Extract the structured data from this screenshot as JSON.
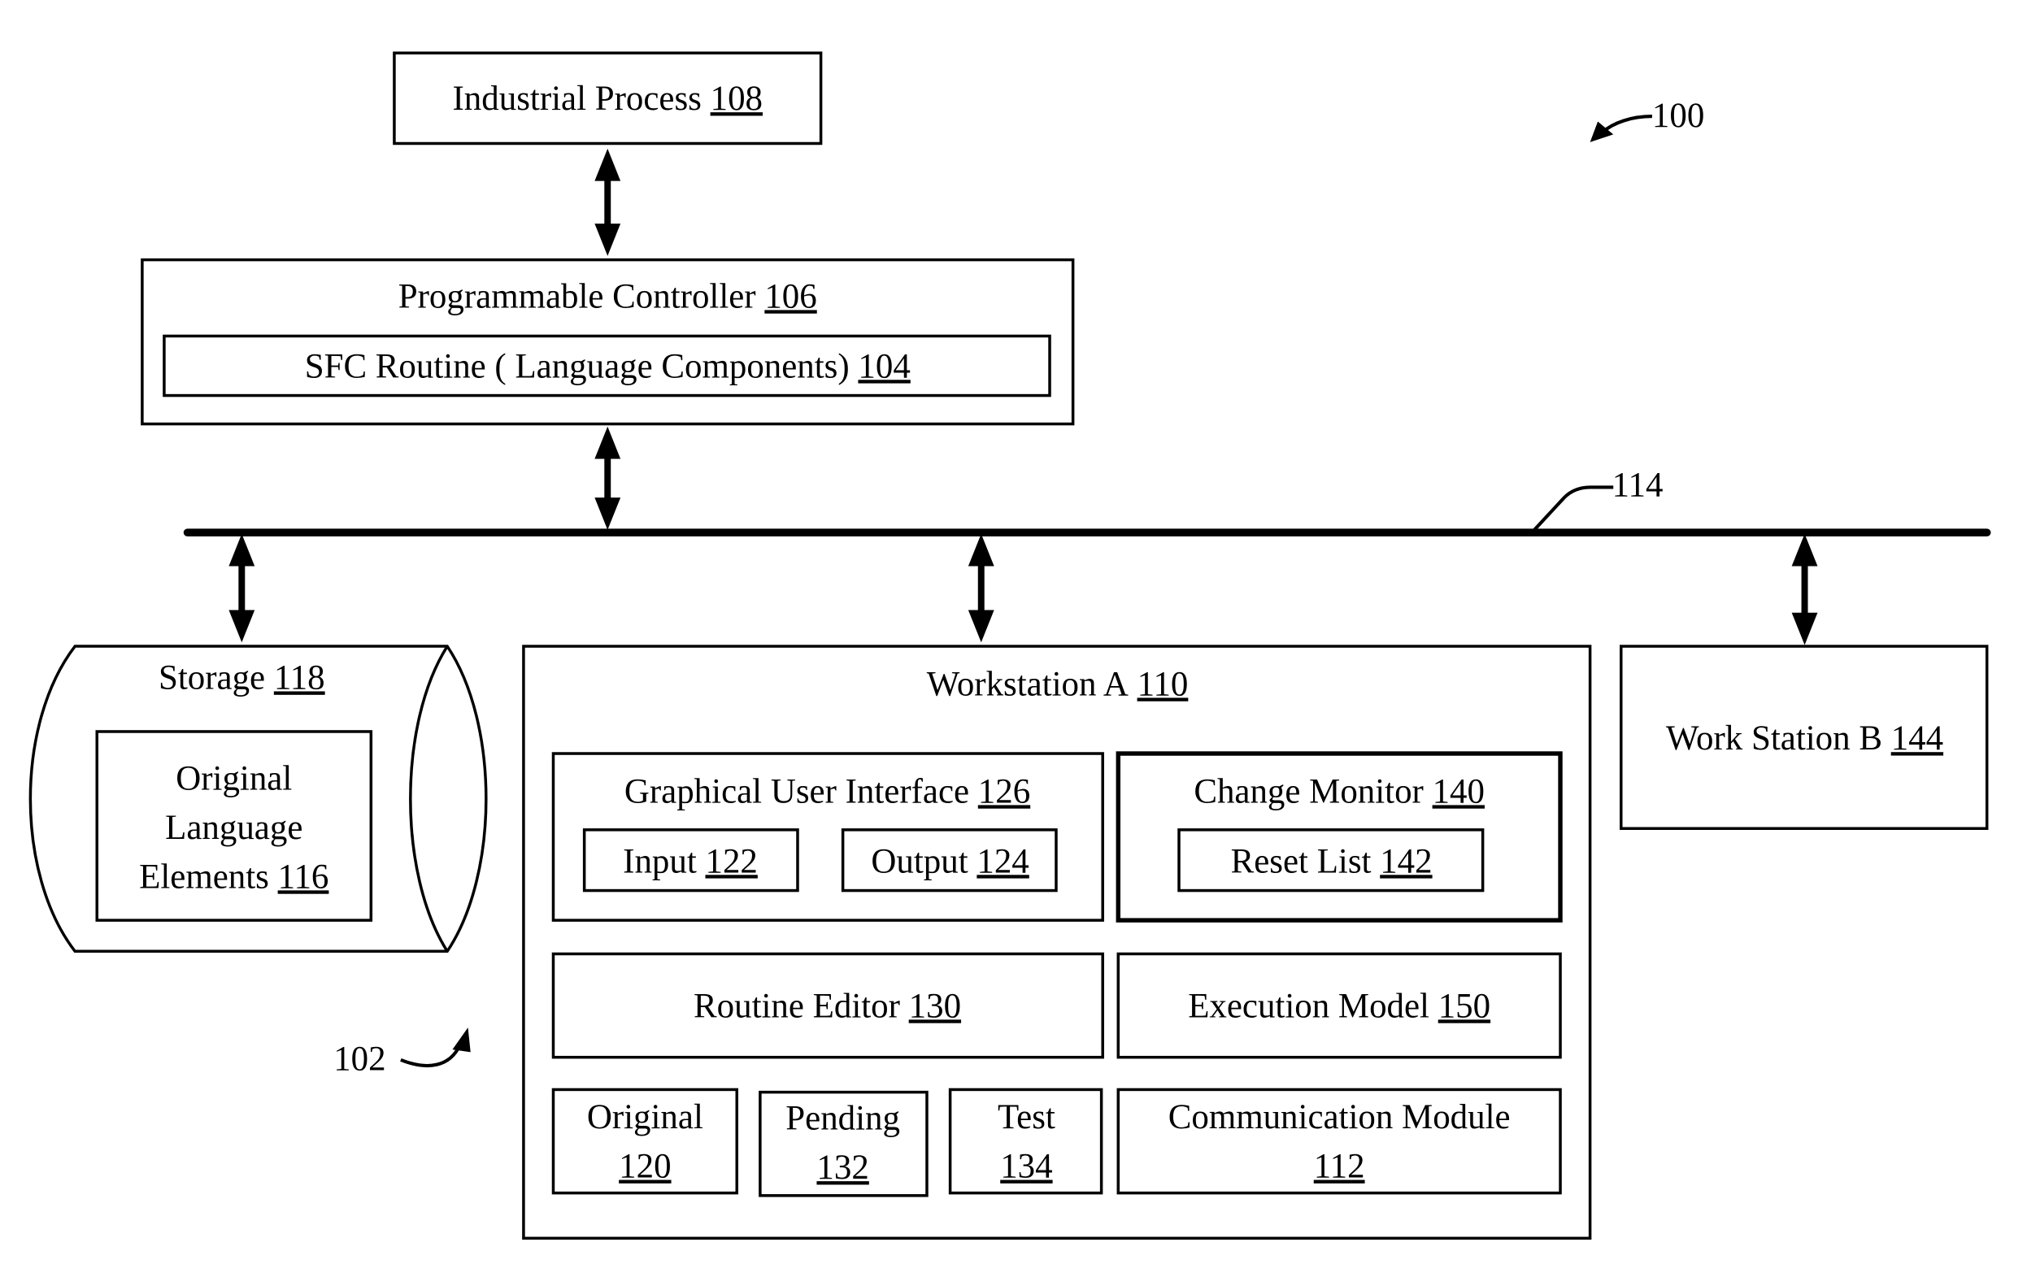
{
  "diagram": {
    "figure_ref": "100",
    "system_ref": "102",
    "bus_ref": "114",
    "industrial_process": {
      "label": "Industrial Process",
      "ref": "108"
    },
    "controller": {
      "label": "Programmable Controller",
      "ref": "106",
      "routine": {
        "label": "SFC Routine ( Language Components)",
        "ref": "104"
      }
    },
    "storage": {
      "label": "Storage",
      "ref": "118",
      "elements": {
        "line1": "Original",
        "line2": "Language",
        "line3": "Elements",
        "ref": "116"
      }
    },
    "workstation_a": {
      "label": "Workstation A",
      "ref": "110",
      "gui": {
        "label": "Graphical User Interface",
        "ref": "126",
        "input": {
          "label": "Input",
          "ref": "122"
        },
        "output": {
          "label": "Output",
          "ref": "124"
        }
      },
      "change_monitor": {
        "label": "Change Monitor",
        "ref": "140",
        "reset_list": {
          "label": "Reset List",
          "ref": "142"
        }
      },
      "routine_editor": {
        "label": "Routine Editor",
        "ref": "130"
      },
      "execution_model": {
        "label": "Execution Model",
        "ref": "150"
      },
      "original": {
        "label": "Original",
        "ref": "120"
      },
      "pending": {
        "label": "Pending",
        "ref": "132"
      },
      "test": {
        "label": "Test",
        "ref": "134"
      },
      "communication_module": {
        "label": "Communication Module",
        "ref": "112"
      }
    },
    "workstation_b": {
      "label": "Work Station B",
      "ref": "144"
    }
  }
}
